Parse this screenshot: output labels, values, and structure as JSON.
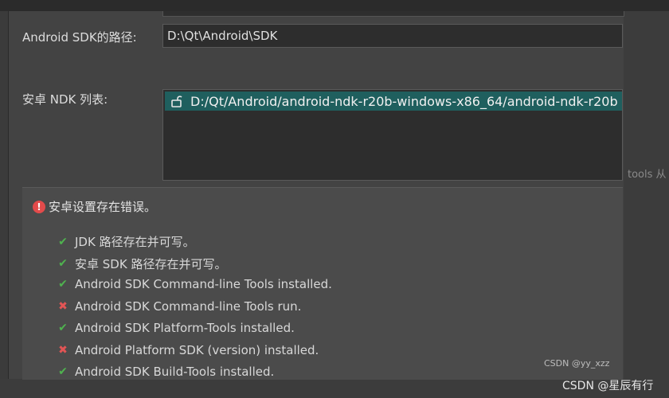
{
  "labels": {
    "sdk_path": "Android SDK的路径:",
    "ndk_list": "安卓 NDK 列表:"
  },
  "sdk_path_value": "D:\\Qt\\Android\\SDK",
  "ndk_items": [
    {
      "path": "D:/Qt/Android/android-ndk-r20b-windows-x86_64/android-ndk-r20b",
      "icon": "unlock-icon"
    }
  ],
  "error": {
    "title": "安卓设置存在错误。",
    "checks": [
      {
        "status": "ok",
        "text": "JDK 路径存在并可写。"
      },
      {
        "status": "ok",
        "text": "安卓 SDK 路径存在并可写。"
      },
      {
        "status": "ok",
        "text": "Android SDK Command-line Tools installed."
      },
      {
        "status": "fail",
        "text": "Android SDK Command-line Tools run."
      },
      {
        "status": "ok",
        "text": "Android SDK Platform-Tools installed."
      },
      {
        "status": "fail",
        "text": "Android Platform SDK (version) installed."
      },
      {
        "status": "ok",
        "text": "Android SDK Build-Tools installed."
      }
    ]
  },
  "background_text": "tools 从",
  "watermarks": {
    "small": "CSDN @yy_xzz",
    "large": "CSDN @星辰有行"
  },
  "colors": {
    "ok": "#4fb24f",
    "fail": "#e25555",
    "selection": "#1f5f5e"
  }
}
